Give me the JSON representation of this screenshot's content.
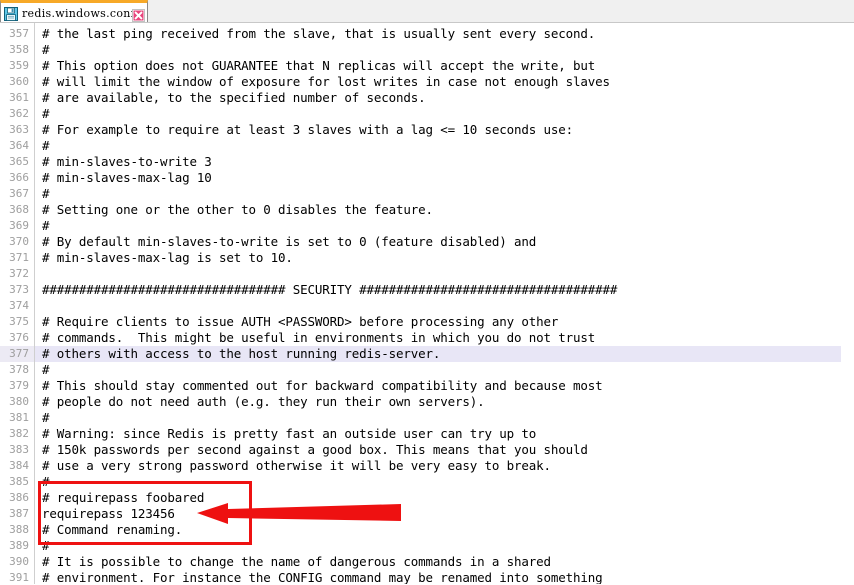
{
  "window": {
    "app": "Notepad++",
    "accent_color": "#f7a928",
    "highlight_color": "#e8e6f6",
    "annotation_color": "#ee1111"
  },
  "tab": {
    "title": "redis.windows.conf",
    "save_icon": "floppy-disk-icon",
    "close_icon": "close-icon",
    "close_label": "✕"
  },
  "editor": {
    "first_line_number": 357,
    "current_line": 377,
    "lines": [
      {
        "n": 357,
        "text": "# the last ping received from the slave, that is usually sent every second."
      },
      {
        "n": 358,
        "text": "#"
      },
      {
        "n": 359,
        "text": "# This option does not GUARANTEE that N replicas will accept the write, but"
      },
      {
        "n": 360,
        "text": "# will limit the window of exposure for lost writes in case not enough slaves"
      },
      {
        "n": 361,
        "text": "# are available, to the specified number of seconds."
      },
      {
        "n": 362,
        "text": "#"
      },
      {
        "n": 363,
        "text": "# For example to require at least 3 slaves with a lag <= 10 seconds use:"
      },
      {
        "n": 364,
        "text": "#"
      },
      {
        "n": 365,
        "text": "# min-slaves-to-write 3"
      },
      {
        "n": 366,
        "text": "# min-slaves-max-lag 10"
      },
      {
        "n": 367,
        "text": "#"
      },
      {
        "n": 368,
        "text": "# Setting one or the other to 0 disables the feature."
      },
      {
        "n": 369,
        "text": "#"
      },
      {
        "n": 370,
        "text": "# By default min-slaves-to-write is set to 0 (feature disabled) and"
      },
      {
        "n": 371,
        "text": "# min-slaves-max-lag is set to 10."
      },
      {
        "n": 372,
        "text": ""
      },
      {
        "n": 373,
        "text": "################################# SECURITY ###################################"
      },
      {
        "n": 374,
        "text": ""
      },
      {
        "n": 375,
        "text": "# Require clients to issue AUTH <PASSWORD> before processing any other"
      },
      {
        "n": 376,
        "text": "# commands.  This might be useful in environments in which you do not trust"
      },
      {
        "n": 377,
        "text": "# others with access to the host running redis-server."
      },
      {
        "n": 378,
        "text": "#"
      },
      {
        "n": 379,
        "text": "# This should stay commented out for backward compatibility and because most"
      },
      {
        "n": 380,
        "text": "# people do not need auth (e.g. they run their own servers)."
      },
      {
        "n": 381,
        "text": "#"
      },
      {
        "n": 382,
        "text": "# Warning: since Redis is pretty fast an outside user can try up to"
      },
      {
        "n": 383,
        "text": "# 150k passwords per second against a good box. This means that you should"
      },
      {
        "n": 384,
        "text": "# use a very strong password otherwise it will be very easy to break."
      },
      {
        "n": 385,
        "text": "#"
      },
      {
        "n": 386,
        "text": "# requirepass foobared"
      },
      {
        "n": 387,
        "text": "requirepass 123456"
      },
      {
        "n": 388,
        "text": "# Command renaming."
      },
      {
        "n": 389,
        "text": "#"
      },
      {
        "n": 390,
        "text": "# It is possible to change the name of dangerous commands in a shared"
      },
      {
        "n": 391,
        "text": "# environment. For instance the CONFIG command may be renamed into something"
      }
    ]
  },
  "annotations": {
    "box": {
      "name": "requirepass-highlight-box",
      "covers_lines": "385-388",
      "color": "#ee1111"
    },
    "arrow": {
      "name": "requirepass-arrow",
      "points_to_line": 387,
      "direction": "left",
      "color": "#ee1111"
    }
  }
}
